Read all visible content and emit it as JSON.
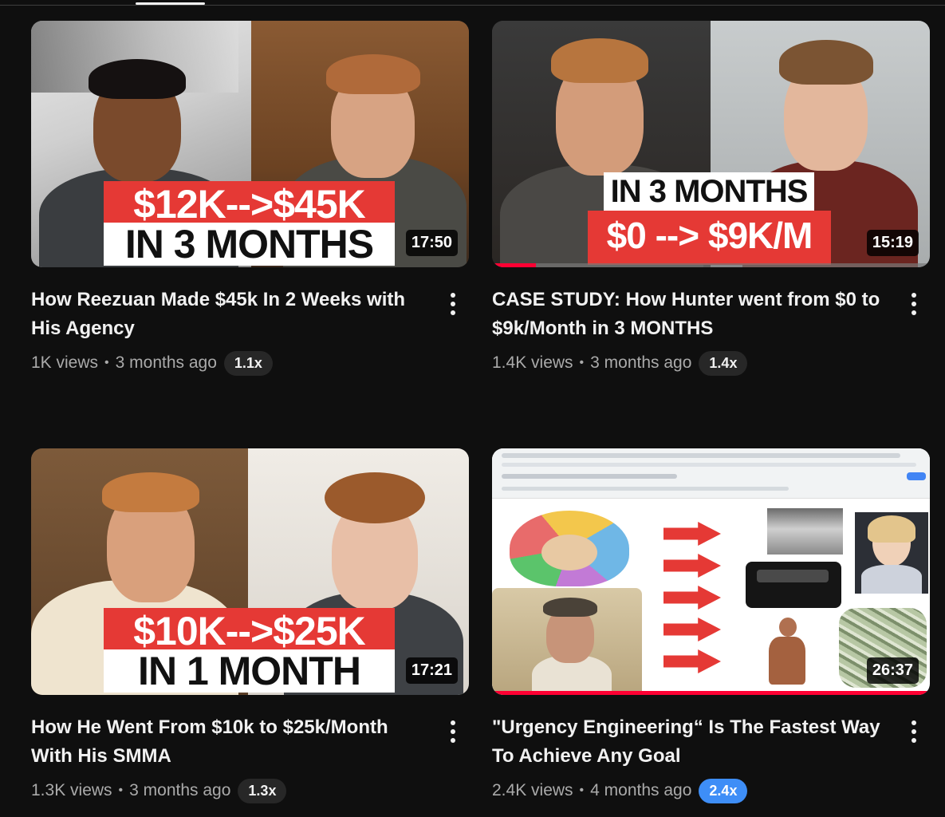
{
  "colors": {
    "background": "#0f0f0f",
    "accent_red": "#ff0033",
    "caption_red": "#e53935",
    "badge_blue": "#3e8ef7"
  },
  "videos": [
    {
      "title": "How Reezuan Made $45k In 2 Weeks with His Agency",
      "views": "1K views",
      "age": "3 months ago",
      "speed": "1.1x",
      "duration": "17:50",
      "caption_top": "$12K-->$45K",
      "caption_bottom": "IN 3 MONTHS",
      "watched_fraction": 0
    },
    {
      "title": "CASE STUDY: How Hunter went from $0 to $9k/Month in 3 MONTHS",
      "views": "1.4K views",
      "age": "3 months ago",
      "speed": "1.4x",
      "duration": "15:19",
      "caption_top": "IN 3 MONTHS",
      "caption_bottom": "$0 --> $9K/M",
      "watched_fraction": 0.1
    },
    {
      "title": "How He Went From $10k to $25k/Month With His SMMA",
      "views": "1.3K views",
      "age": "3 months ago",
      "speed": "1.3x",
      "duration": "17:21",
      "caption_top": "$10K-->$25K",
      "caption_bottom": "IN 1 MONTH",
      "watched_fraction": 0
    },
    {
      "title": "\"Urgency Engineering“ Is The Fastest Way To Achieve Any Goal",
      "views": "2.4K views",
      "age": "4 months ago",
      "speed": "2.4x",
      "duration": "26:37",
      "watched_fraction": 1
    }
  ],
  "separator": "•"
}
